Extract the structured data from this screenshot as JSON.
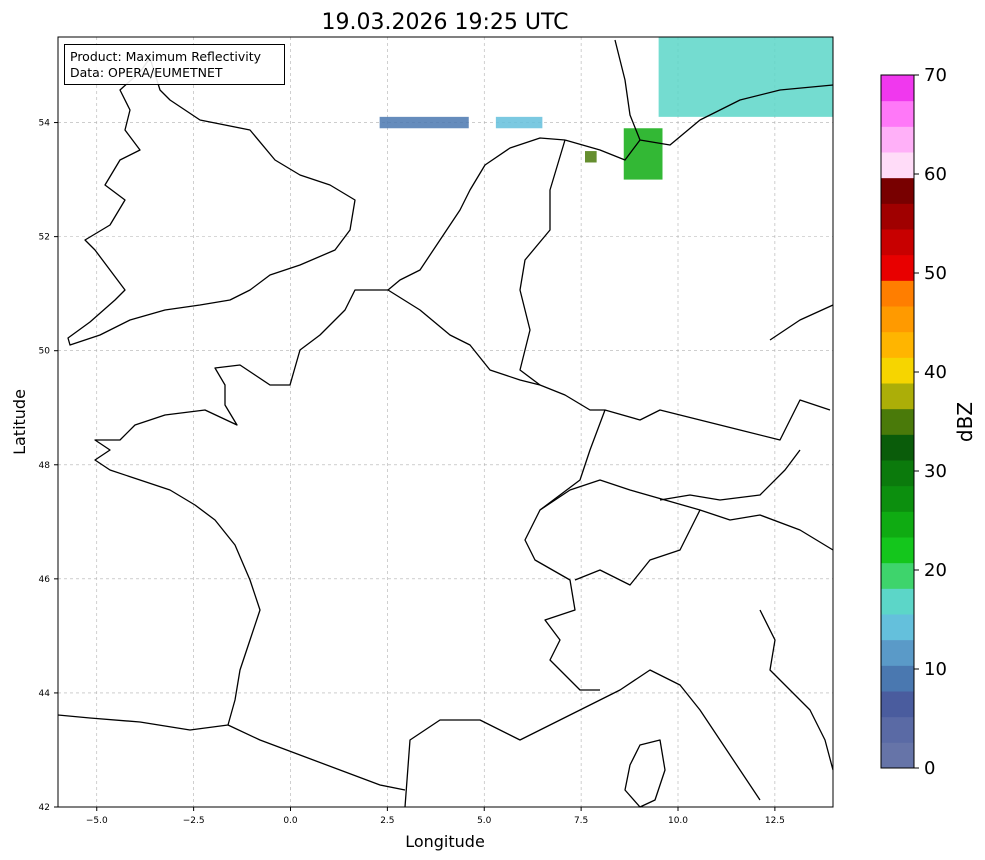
{
  "chart_data": {
    "type": "heatmap",
    "title": "19.03.2026 19:25 UTC",
    "xlabel": "Longitude",
    "ylabel": "Latitude",
    "xlim": [
      -6,
      14
    ],
    "ylim": [
      42,
      55.5
    ],
    "xticks": [
      -5.0,
      -2.5,
      0.0,
      2.5,
      5.0,
      7.5,
      10.0,
      12.5
    ],
    "xtick_labels": [
      "−5.0",
      "−2.5",
      "0.0",
      "2.5",
      "5.0",
      "7.5",
      "10.0",
      "12.5"
    ],
    "yticks": [
      42,
      44,
      46,
      48,
      50,
      52,
      54
    ],
    "ytick_labels": [
      "42",
      "44",
      "46",
      "48",
      "50",
      "52",
      "54"
    ],
    "grid": true,
    "annotation": [
      "Product: Maximum Reflectivity",
      "Data: OPERA/EUMETNET"
    ],
    "colorbar": {
      "label": "dBZ",
      "min": 0,
      "max": 70,
      "ticks": [
        0,
        10,
        20,
        30,
        40,
        50,
        60,
        70
      ],
      "colors": [
        "#6674a8",
        "#5a6aa5",
        "#4a5c9e",
        "#4a78b0",
        "#5a9ac8",
        "#64c0dc",
        "#5cd6c8",
        "#3ed46c",
        "#14c61c",
        "#0fab12",
        "#0c8f0e",
        "#0b7a0c",
        "#0a5c0a",
        "#4a7a0a",
        "#acae08",
        "#f6d500",
        "#ffb500",
        "#ff9a00",
        "#ff7e00",
        "#e80000",
        "#c80000",
        "#a00000",
        "#780000",
        "#ffdcf8",
        "#ffb0f8",
        "#ff78f8",
        "#f038ee"
      ]
    },
    "echoes": [
      {
        "lon_range": [
          2.3,
          4.6
        ],
        "lat_range": [
          53.9,
          54.1
        ],
        "dbz": 8
      },
      {
        "lon_range": [
          5.3,
          6.5
        ],
        "lat_range": [
          53.9,
          54.1
        ],
        "dbz": 15
      },
      {
        "lon_range": [
          8.6,
          9.6
        ],
        "lat_range": [
          53.0,
          53.9
        ],
        "dbz": 25
      },
      {
        "lon_range": [
          9.5,
          14.0
        ],
        "lat_range": [
          54.1,
          55.5
        ],
        "dbz": 18
      },
      {
        "lon_range": [
          7.6,
          7.9
        ],
        "lat_range": [
          53.3,
          53.5
        ],
        "dbz": 35
      }
    ]
  }
}
